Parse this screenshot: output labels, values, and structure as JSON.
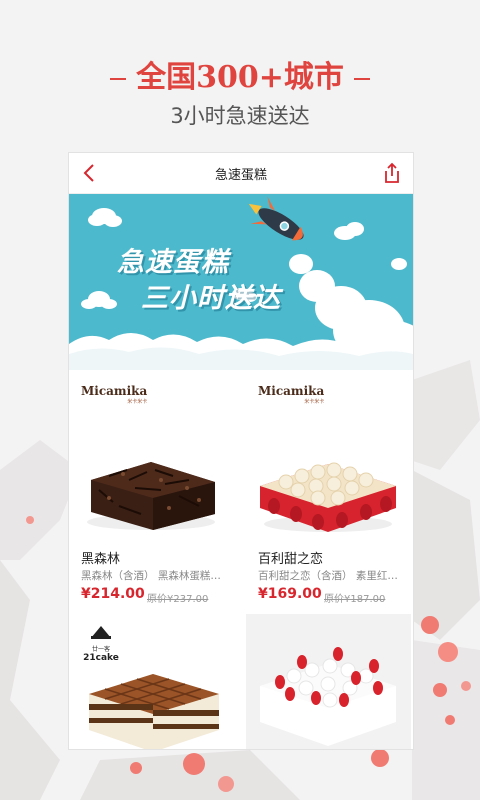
{
  "promo": {
    "headline": "全国300+城市",
    "subline": "3小时急速送达"
  },
  "nav": {
    "title": "急速蛋糕"
  },
  "banner": {
    "line1": "急速蛋糕",
    "line2": "三小时送达"
  },
  "products": [
    {
      "brand": "Micamika",
      "brand_sub": "米卡米卡",
      "name": "黑森林",
      "desc": "黑森林（含酒） 黑森林蛋糕…",
      "price": "¥214.00",
      "original": "原价¥237.00"
    },
    {
      "brand": "Micamika",
      "brand_sub": "米卡米卡",
      "name": "百利甜之恋",
      "desc": "百利甜之恋（含酒） 素里红…",
      "price": "¥169.00",
      "original": "原价¥187.00"
    },
    {
      "brand": "21cake",
      "brand_sub": "廿一客"
    },
    {}
  ],
  "colors": {
    "accent": "#e0443f",
    "price": "#d8262e",
    "banner": "#4db9cc"
  }
}
